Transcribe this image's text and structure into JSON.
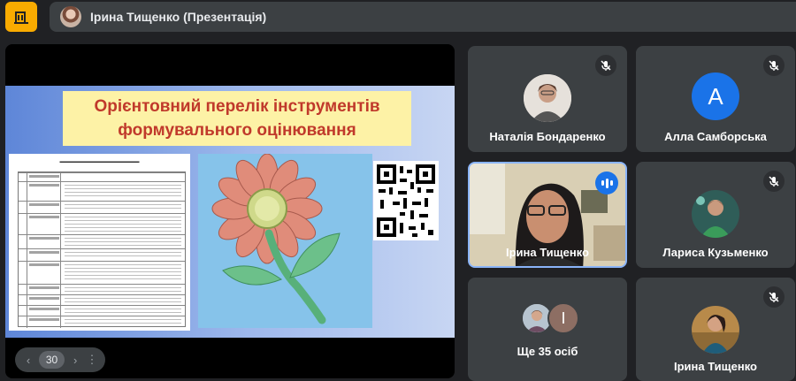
{
  "app": {
    "logo_icon": "building-icon",
    "accent": "#f9ab00"
  },
  "header": {
    "title": "Ірина Тищенко (Презентація)"
  },
  "presentation": {
    "slide_title_line1": "Орієнтовний перелік інструментів",
    "slide_title_line2": "формувального оцінювання",
    "slide_title_color": "#c0392b",
    "page_number": "30",
    "prev_icon": "chevron-left-icon",
    "next_icon": "chevron-right-icon",
    "more_icon": "more-vert-icon"
  },
  "participants": [
    {
      "name": "Наталія Бондаренко",
      "muted": true,
      "avatar": "photo"
    },
    {
      "name": "Алла Самборська",
      "muted": true,
      "avatar": "A",
      "avatar_color": "#1a73e8"
    },
    {
      "name": "Ірина Тищенко",
      "muted": false,
      "speaking": true
    },
    {
      "name": "Лариса Кузьменко",
      "muted": true,
      "avatar": "photo"
    },
    {
      "name": "Ще 35 осіб",
      "avatar_letter": "I"
    },
    {
      "name": "Ірина Тищенко",
      "muted": true,
      "avatar": "photo"
    }
  ]
}
